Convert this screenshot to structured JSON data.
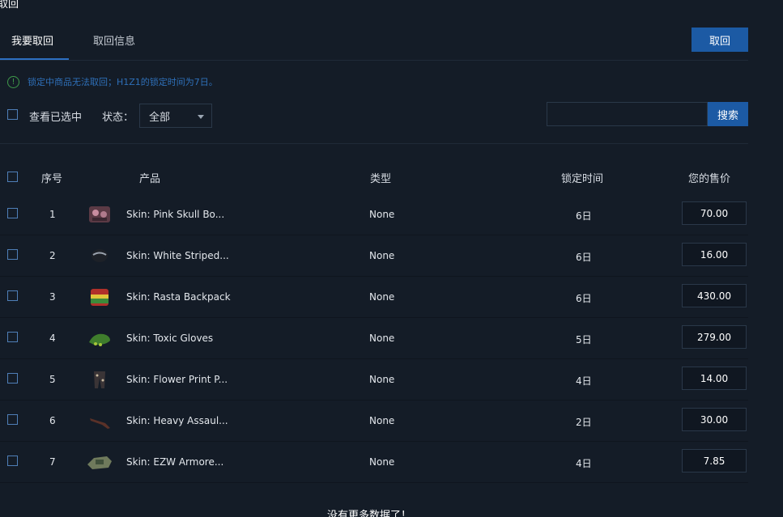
{
  "page_title": "取回",
  "tabs": [
    {
      "label": "我要取回"
    },
    {
      "label": "取回信息"
    }
  ],
  "withdraw_button": "取回",
  "notice": {
    "icon": "exclamation-circle-icon",
    "text": "锁定中商品无法取回；H1Z1的锁定时间为7日。"
  },
  "filters": {
    "view_selected_label": "查看已选中",
    "status_label": "状态：",
    "status_value": "全部",
    "search_value": "",
    "search_button": "搜索"
  },
  "table": {
    "headers": {
      "index": "序号",
      "product": "产品",
      "type": "类型",
      "lock_time": "锁定时间",
      "price": "您的售价"
    },
    "rows": [
      {
        "index": "1",
        "name": "Skin: Pink Skull Bo...",
        "type": "None",
        "lock": "6日",
        "price": "70.00",
        "thumb": "pink-skull-item"
      },
      {
        "index": "2",
        "name": "Skin: White Striped...",
        "type": "None",
        "lock": "6日",
        "price": "16.00",
        "thumb": "white-striped-helmet"
      },
      {
        "index": "3",
        "name": "Skin: Rasta Backpack",
        "type": "None",
        "lock": "6日",
        "price": "430.00",
        "thumb": "rasta-backpack"
      },
      {
        "index": "4",
        "name": "Skin: Toxic Gloves",
        "type": "None",
        "lock": "5日",
        "price": "279.00",
        "thumb": "toxic-gloves"
      },
      {
        "index": "5",
        "name": "Skin: Flower Print P...",
        "type": "None",
        "lock": "4日",
        "price": "14.00",
        "thumb": "flower-print-pants"
      },
      {
        "index": "6",
        "name": "Skin: Heavy Assaul...",
        "type": "None",
        "lock": "2日",
        "price": "30.00",
        "thumb": "heavy-assault-rifle"
      },
      {
        "index": "7",
        "name": "Skin: EZW Armore...",
        "type": "None",
        "lock": "4日",
        "price": "7.85",
        "thumb": "ezw-armored-vehicle"
      }
    ]
  },
  "footer_note": "没有更多数据了！",
  "colors": {
    "background": "#141c27",
    "accent": "#1c5aa4",
    "notice": "#2e6fb8"
  }
}
